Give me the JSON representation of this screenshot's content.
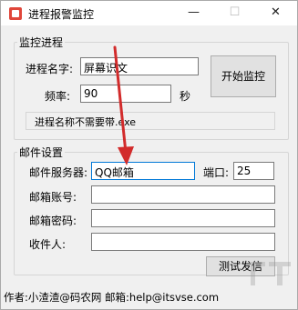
{
  "window": {
    "title": "进程报警监控",
    "minimize_glyph": "—",
    "maximize_glyph": "☐",
    "close_glyph": "✕"
  },
  "monitor_group": {
    "title": "监控进程",
    "process_name_label": "进程名字:",
    "process_name_value": "屏幕识文",
    "frequency_label": "频率:",
    "frequency_value": "90",
    "frequency_unit": "秒",
    "start_button": "开始监控",
    "hint": "进程名称不需要带.exe"
  },
  "mail_group": {
    "title": "邮件设置",
    "server_label": "邮件服务器:",
    "server_value": "QQ邮箱",
    "port_label": "端口:",
    "port_value": "25",
    "account_label": "邮箱账号:",
    "account_value": "",
    "password_label": "邮箱密码:",
    "password_value": "",
    "recipient_label": "收件人:",
    "recipient_value": "",
    "test_button": "测试发信"
  },
  "footer": {
    "text": "作者:小渣渣@码农网  邮箱:help@itsvse.com"
  },
  "colors": {
    "arrow": "#d22b2b",
    "focus_border": "#0078d7"
  }
}
